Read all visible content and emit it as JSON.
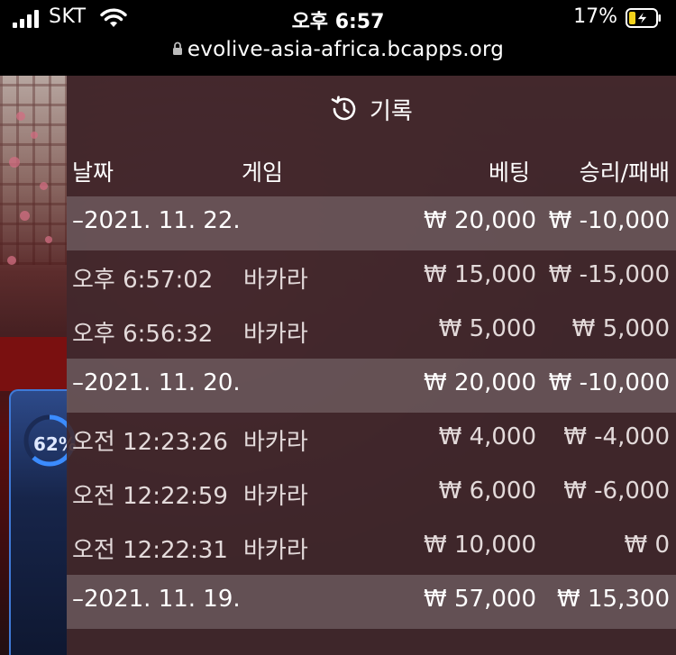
{
  "status_bar": {
    "carrier": "SKT",
    "time": "오후 6:57",
    "battery_percent": "17%"
  },
  "browser": {
    "url": "evolive-asia-africa.bcapps.org"
  },
  "side_widget": {
    "percent": "62%"
  },
  "history": {
    "title": "기록",
    "columns": {
      "date": "날짜",
      "game": "게임",
      "bet": "베팅",
      "win_loss": "승리/패배"
    },
    "rows": [
      {
        "type": "group",
        "date": "–2021. 11. 22.",
        "game": "",
        "bet": "₩ 20,000",
        "win_loss": "₩ -10,000"
      },
      {
        "type": "item",
        "date": "오후 6:57:02",
        "game": "바카라",
        "bet": "₩ 15,000",
        "win_loss": "₩ -15,000"
      },
      {
        "type": "item",
        "date": "오후 6:56:32",
        "game": "바카라",
        "bet": "₩ 5,000",
        "win_loss": "₩ 5,000"
      },
      {
        "type": "group",
        "date": "–2021. 11. 20.",
        "game": "",
        "bet": "₩ 20,000",
        "win_loss": "₩ -10,000"
      },
      {
        "type": "item",
        "date": "오전 12:23:26",
        "game": "바카라",
        "bet": "₩ 4,000",
        "win_loss": "₩ -4,000"
      },
      {
        "type": "item",
        "date": "오전 12:22:59",
        "game": "바카라",
        "bet": "₩ 6,000",
        "win_loss": "₩ -6,000"
      },
      {
        "type": "item",
        "date": "오전 12:22:31",
        "game": "바카라",
        "bet": "₩ 10,000",
        "win_loss": "₩ 0"
      },
      {
        "type": "group",
        "date": "–2021. 11. 19.",
        "game": "",
        "bet": "₩ 57,000",
        "win_loss": "₩ 15,300"
      }
    ]
  }
}
